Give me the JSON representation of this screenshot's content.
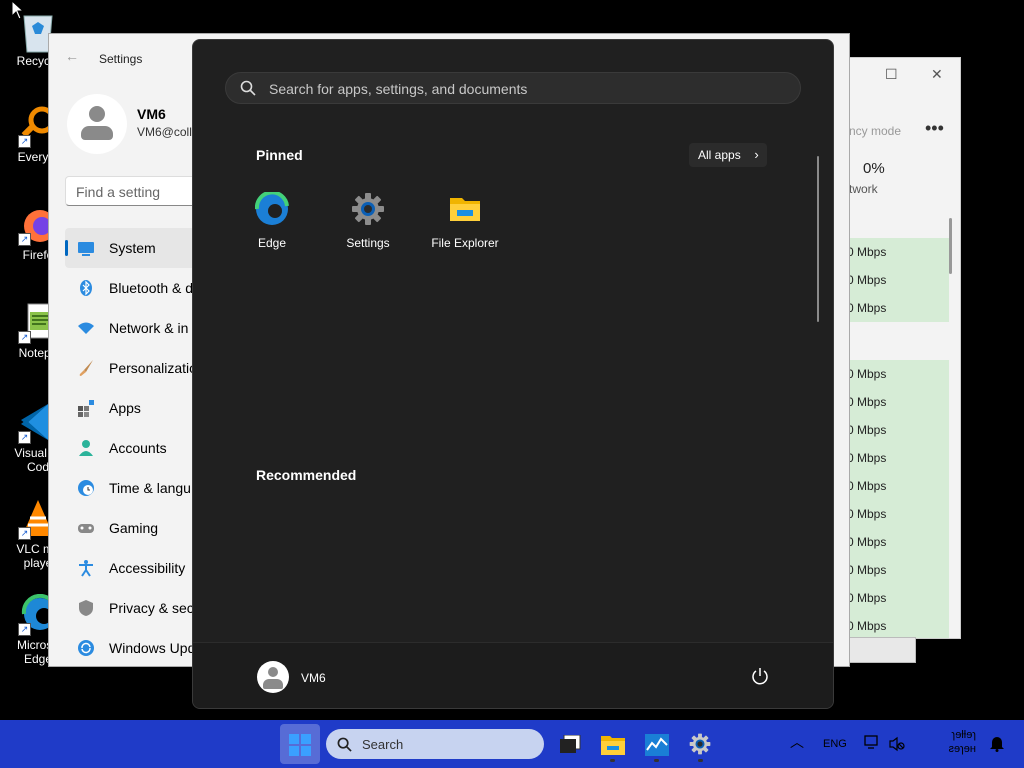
{
  "desktop": {
    "icons": [
      {
        "label": "Recycle",
        "icon": "recycle-bin-icon"
      },
      {
        "label": "Everyth",
        "icon": "everything-search-icon"
      },
      {
        "label": "Firefo",
        "icon": "firefox-icon"
      },
      {
        "label": "Notepa",
        "icon": "notepad-icon"
      },
      {
        "label": "Visual St",
        "label2": "Cod",
        "icon": "vscode-icon"
      },
      {
        "label": "VLC me",
        "label2": "playe",
        "icon": "vlc-icon"
      },
      {
        "label": "Microso",
        "label2": "Edge",
        "icon": "edge-icon"
      }
    ]
  },
  "taskmgr": {
    "toolbar_text": "ncy mode",
    "network_percent": "0%",
    "network_label": "twork",
    "rows": [
      "",
      "0 Mbps",
      "0 Mbps",
      "0 Mbps",
      "",
      "0 Mbps",
      "0 Mbps",
      "0 Mbps",
      "0 Mbps",
      "0 Mbps",
      "0 Mbps",
      "0 Mbps",
      "0 Mbps",
      "0 Mbps",
      "0 Mbps"
    ]
  },
  "settings": {
    "title": "Settings",
    "user_name": "VM6",
    "user_email": "VM6@coll",
    "search_placeholder": "Find a setting",
    "nav": [
      {
        "label": "System",
        "icon": "system-icon",
        "active": true
      },
      {
        "label": "Bluetooth & d",
        "icon": "bluetooth-icon"
      },
      {
        "label": "Network & in",
        "icon": "network-icon"
      },
      {
        "label": "Personalizatio",
        "icon": "personalization-icon"
      },
      {
        "label": "Apps",
        "icon": "apps-icon"
      },
      {
        "label": "Accounts",
        "icon": "accounts-icon"
      },
      {
        "label": "Time & langu",
        "icon": "time-language-icon"
      },
      {
        "label": "Gaming",
        "icon": "gaming-icon"
      },
      {
        "label": "Accessibility",
        "icon": "accessibility-icon"
      },
      {
        "label": "Privacy & secu",
        "icon": "privacy-icon"
      },
      {
        "label": "Windows Upd",
        "icon": "windows-update-icon"
      }
    ]
  },
  "start_menu": {
    "search_placeholder": "Search for apps, settings, and documents",
    "pinned_heading": "Pinned",
    "all_apps_label": "All apps",
    "pinned_apps": [
      {
        "label": "Edge",
        "icon": "edge-icon"
      },
      {
        "label": "Settings",
        "icon": "settings-gear-icon"
      },
      {
        "label": "File Explorer",
        "icon": "folder-icon"
      }
    ],
    "recommended_heading": "Recommended",
    "user_name": "VM6"
  },
  "taskbar": {
    "search_placeholder": "Search",
    "language": "ENG",
    "clock_time": "ɿɘƚƚɘɿ",
    "clock_date": "ƨɘɿɘʜ"
  },
  "colors": {
    "taskbar": "#1f3bc8",
    "start_bg": "#202020",
    "accent": "#0067c0"
  }
}
